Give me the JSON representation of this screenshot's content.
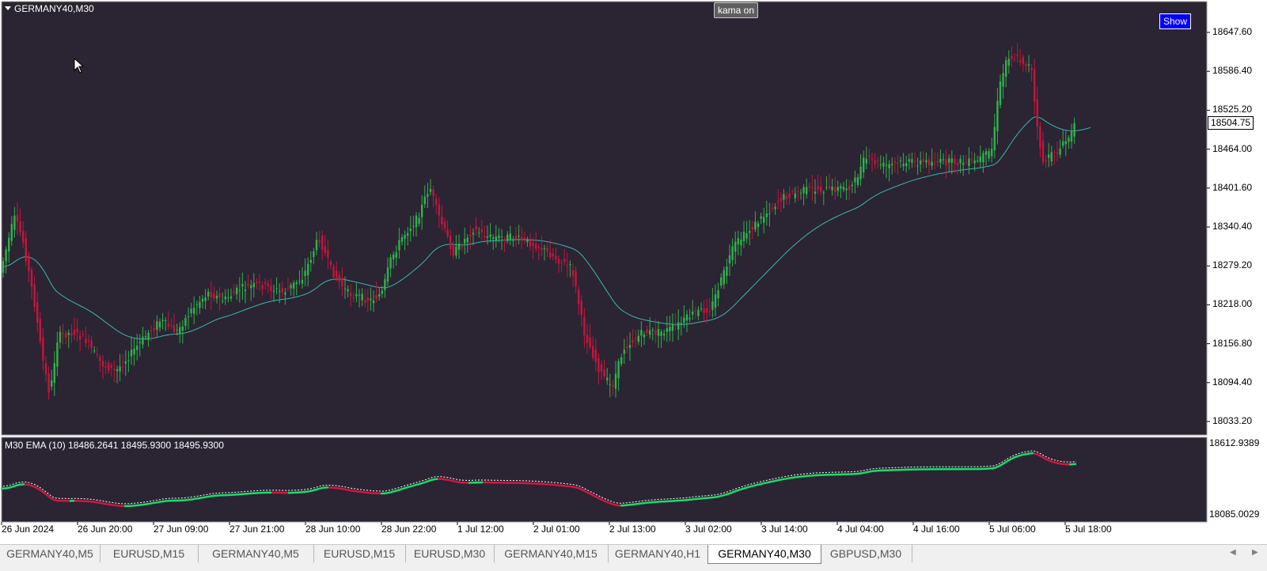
{
  "chart": {
    "symbol": "GERMANY40,M30",
    "kama_button": "kama on",
    "show_button": "Show",
    "current_price": "18504.75",
    "price_axis": [
      "18647.60",
      "18586.40",
      "18525.20",
      "18464.00",
      "18401.60",
      "18340.40",
      "18279.20",
      "18218.00",
      "18156.80",
      "18094.40",
      "18033.20"
    ],
    "indicator_label": "M30 EMA (10) 18486.2641 18495.9300 18495.9300",
    "indicator_axis": [
      "18612.9389",
      "18085.0029"
    ],
    "time_axis": [
      "26 Jun 2024",
      "26 Jun 20:00",
      "27 Jun 09:00",
      "27 Jun 21:00",
      "28 Jun 10:00",
      "28 Jun 22:00",
      "1 Jul 12:00",
      "2 Jul 01:00",
      "2 Jul 13:00",
      "3 Jul 02:00",
      "3 Jul 14:00",
      "4 Jul 04:00",
      "4 Jul 16:00",
      "5 Jul 06:00",
      "5 Jul 18:00"
    ],
    "colors": {
      "background": "#2a2433",
      "bull": "#2fb34a",
      "bear": "#c8143c",
      "kama_line": "#3fb6b0",
      "ema_up": "#17e06a",
      "ema_down": "#d6163f",
      "signal_line": "#ffffff"
    }
  },
  "tabs": [
    {
      "label": "GERMANY40,M5",
      "active": false
    },
    {
      "label": "EURUSD,M15",
      "active": false
    },
    {
      "label": "GERMANY40,M5",
      "active": false
    },
    {
      "label": "EURUSD,M15",
      "active": false
    },
    {
      "label": "EURUSD,M30",
      "active": false
    },
    {
      "label": "GERMANY40,M15",
      "active": false
    },
    {
      "label": "GERMANY40,H1",
      "active": false
    },
    {
      "label": "GERMANY40,M30",
      "active": true
    },
    {
      "label": "GBPUSD,M30",
      "active": false
    }
  ],
  "icons": {
    "scroll_left": "left-arrow-icon",
    "scroll_right": "right-arrow-icon",
    "cursor": "mouse-cursor-icon"
  }
}
